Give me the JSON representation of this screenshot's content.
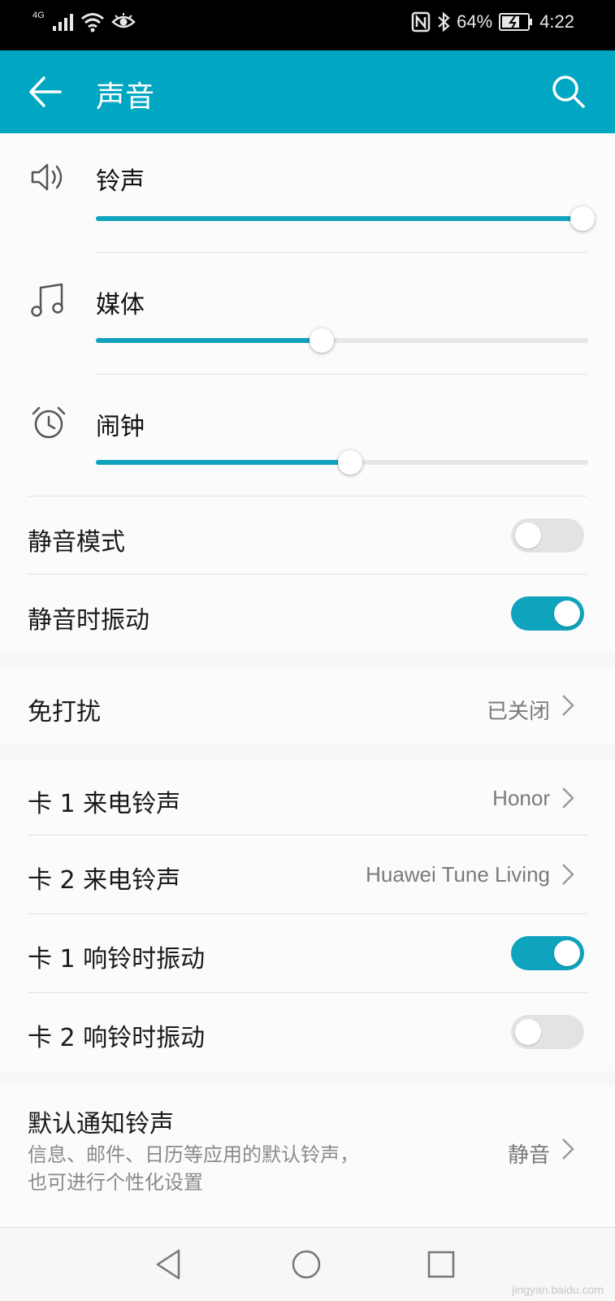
{
  "status_bar": {
    "network": "4G",
    "battery": "64%",
    "time": "4:22"
  },
  "app_bar": {
    "title": "声音"
  },
  "volumes": [
    {
      "label": "铃声",
      "icon": "speaker-icon",
      "level": 1.0
    },
    {
      "label": "媒体",
      "icon": "music-note-icon",
      "level": 0.47
    },
    {
      "label": "闹钟",
      "icon": "alarm-clock-icon",
      "level": 0.53
    }
  ],
  "toggles_top": [
    {
      "label": "静音模式",
      "on": false
    },
    {
      "label": "静音时振动",
      "on": true
    }
  ],
  "dnd": {
    "label": "免打扰",
    "value": "已关闭"
  },
  "ringtones": [
    {
      "label": "卡 1 来电铃声",
      "value": "Honor"
    },
    {
      "label": "卡 2 来电铃声",
      "value": "Huawei Tune Living"
    }
  ],
  "ring_vibrate": [
    {
      "label": "卡 1 响铃时振动",
      "on": true
    },
    {
      "label": "卡 2 响铃时振动",
      "on": false
    }
  ],
  "notification": {
    "label": "默认通知铃声",
    "subtitle": "信息、邮件、日历等应用的默认铃声，也可进行个性化设置",
    "value": "静音"
  },
  "colors": {
    "accent": "#01a7c2",
    "toggle_on": "#10a3bd"
  },
  "watermark": "jingyan.baidu.com"
}
